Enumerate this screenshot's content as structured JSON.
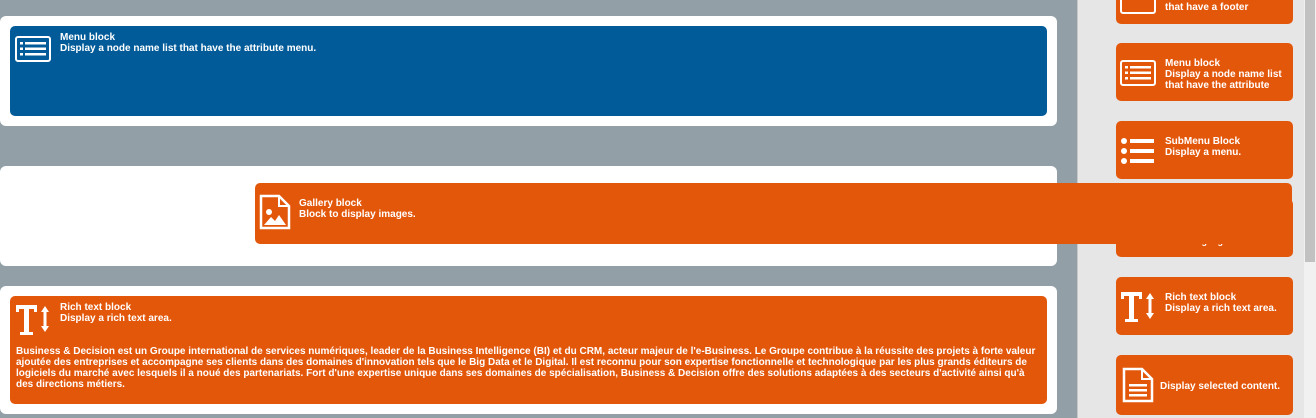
{
  "canvas": {
    "menu_block": {
      "title": "Menu block",
      "description": "Display a node name list that have the attribute menu.",
      "icon": "list-icon"
    },
    "gallery_block": {
      "title": "Gallery block",
      "description": "Block to display images.",
      "icon": "image-icon"
    },
    "richtext_block": {
      "title": "Rich text block",
      "description": "Display a rich text area.",
      "icon": "text-cursor-icon",
      "content": "Business & Decision est un Groupe international de services numériques, leader de la Business Intelligence (BI) et du CRM, acteur majeur de l'e-Business. Le Groupe contribue à la réussite des projets à forte valeur ajoutée des entreprises et accompagne ses clients dans des domaines d'innovation tels que le Big Data et le Digital. Il est reconnu pour son expertise fonctionnelle et technologique par les plus grands éditeurs de logiciels du marché avec lesquels il a noué des partenariats. Fort d'une expertise unique dans ses domaines de spécialisation, Business & Decision offre des solutions adaptées à des secteurs d'activité ainsi qu'à des directions métiers."
    }
  },
  "palette": {
    "footer_item": {
      "desc_tail": "that have a footer"
    },
    "menu_item": {
      "title": "Menu block",
      "description": "Display a node name list",
      "description_2": "that have the attribute"
    },
    "submenu_item": {
      "title": "SubMenu Block",
      "description": "Display a menu."
    },
    "language_item": {
      "description_partial": "all the languages of the"
    },
    "richtext_item": {
      "title": "Rich text block",
      "description": "Display a rich text area."
    },
    "content_item": {
      "label": "Display selected content."
    }
  },
  "colors": {
    "orange": "#e3570b",
    "blue": "#015b99",
    "canvas_bg": "#929fa6",
    "palette_bg": "#e6e6e6"
  }
}
